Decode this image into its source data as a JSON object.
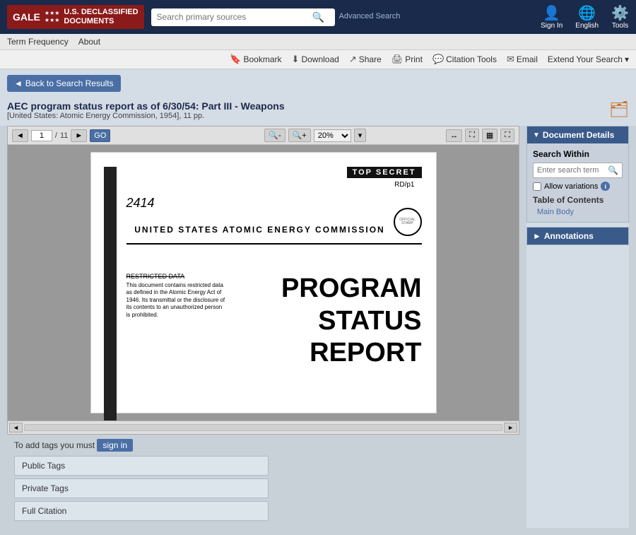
{
  "site": {
    "brand": "GALE",
    "brand_subtitle": "U.S. DECLASSIFIED\nDOCUMENTS",
    "search_placeholder": "Search primary sources",
    "advanced_search": "Advanced\nSearch",
    "signin_label": "Sign In",
    "language_label": "English",
    "tools_label": "Tools"
  },
  "secondary_nav": {
    "items": [
      "Term Frequency",
      "About"
    ]
  },
  "action_bar": {
    "items": [
      "Bookmark",
      "Download",
      "Share",
      "Print",
      "Citation Tools",
      "Email",
      "Extend Your Search"
    ]
  },
  "back_button": {
    "label": "Back to Search Results"
  },
  "document": {
    "title": "AEC program status report as of 6/30/54: Part III - Weapons",
    "citation": "[United States: Atomic Energy Commission, 1954], 11 pp.",
    "page_current": "1",
    "page_total": "11",
    "zoom": "20%",
    "content": {
      "top_secret": "TOP SECRET",
      "rd_ref": "RD/p1",
      "doc_num": "2414",
      "agency": "UNITED STATES ATOMIC ENERGY COMMISSION",
      "restricted_title": "RESTRICTED DATA",
      "restricted_body": "This document contains restricted data as defined in the Atomic Energy Act of 1946. Its transmittal or the disclosure of its contents to an unauthorized person is prohibited.",
      "program_line1": "PROGRAM",
      "program_line2": "STATUS",
      "program_line3": "REPORT"
    }
  },
  "tags": {
    "signin_prompt": "To add tags you must",
    "signin_label": "sign in",
    "public_tags": "Public Tags",
    "private_tags": "Private Tags",
    "full_citation": "Full Citation"
  },
  "right_panel": {
    "document_details_label": "Document Details",
    "search_within_placeholder": "Enter search term",
    "allow_variations_label": "Allow variations",
    "toc_label": "Table of Contents",
    "toc_items": [
      "Main Body"
    ],
    "annotations_label": "Annotations"
  }
}
